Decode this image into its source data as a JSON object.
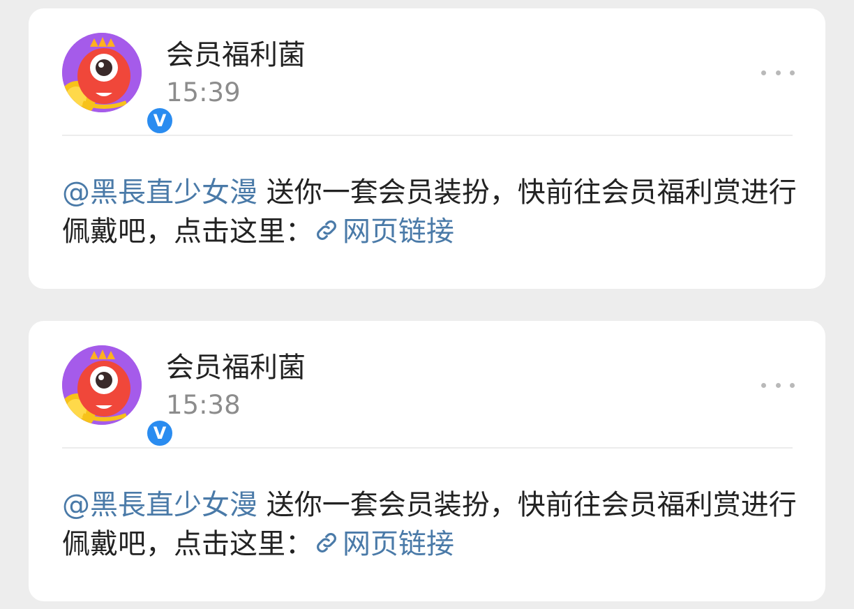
{
  "posts": [
    {
      "author": "会员福利菌",
      "time": "15:39",
      "verified_mark": "V",
      "mention": "@黑長直少女漫",
      "message": " 送你一套会员装扮，快前往会员福利赏进行佩戴吧，点击这里：",
      "link_label": "网页链接"
    },
    {
      "author": "会员福利菌",
      "time": "15:38",
      "verified_mark": "V",
      "mention": "@黑長直少女漫",
      "message": " 送你一套会员装扮，快前往会员福利赏进行佩戴吧，点击这里：",
      "link_label": "网页链接"
    }
  ],
  "colors": {
    "link": "#4a7aa8",
    "verified": "#2a8cf0",
    "background": "#ededed"
  },
  "icons": {
    "more": "more-dots-icon",
    "link": "link-chain-icon",
    "verified": "verified-v-icon"
  }
}
